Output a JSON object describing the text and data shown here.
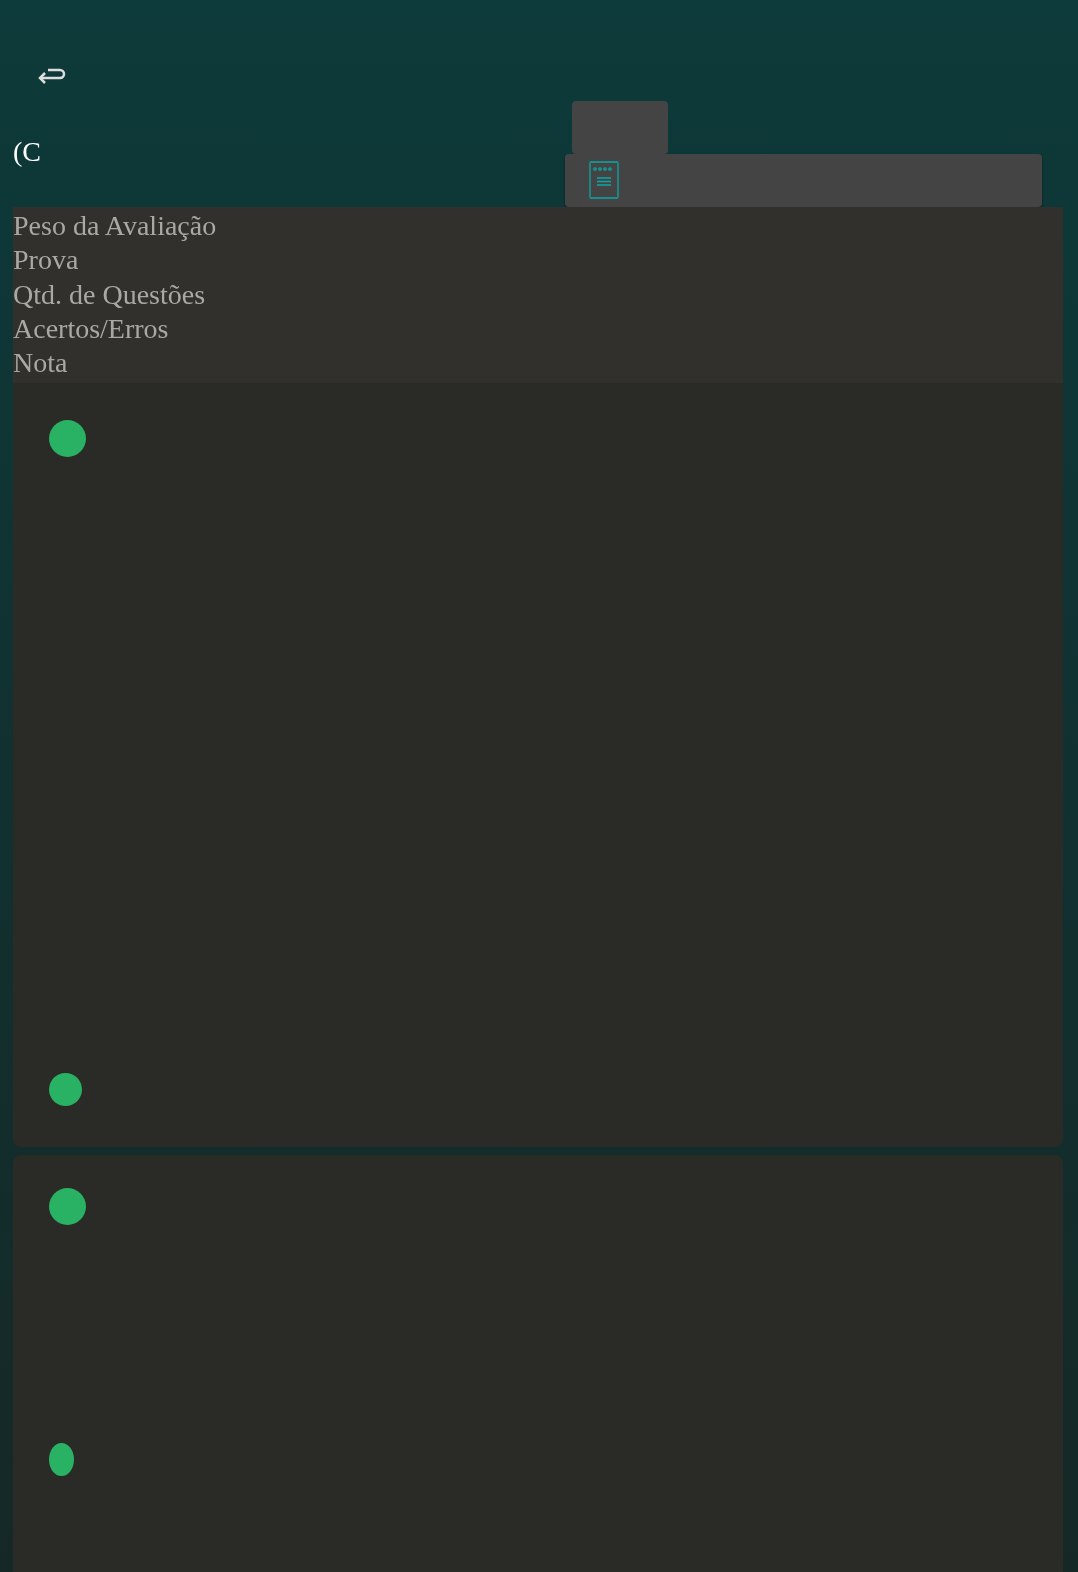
{
  "title": "(C",
  "table_header": [
    "Peso da Avaliação",
    "Prova",
    "Qtd. de Questões",
    "Acertos/Erros",
    "Nota"
  ]
}
